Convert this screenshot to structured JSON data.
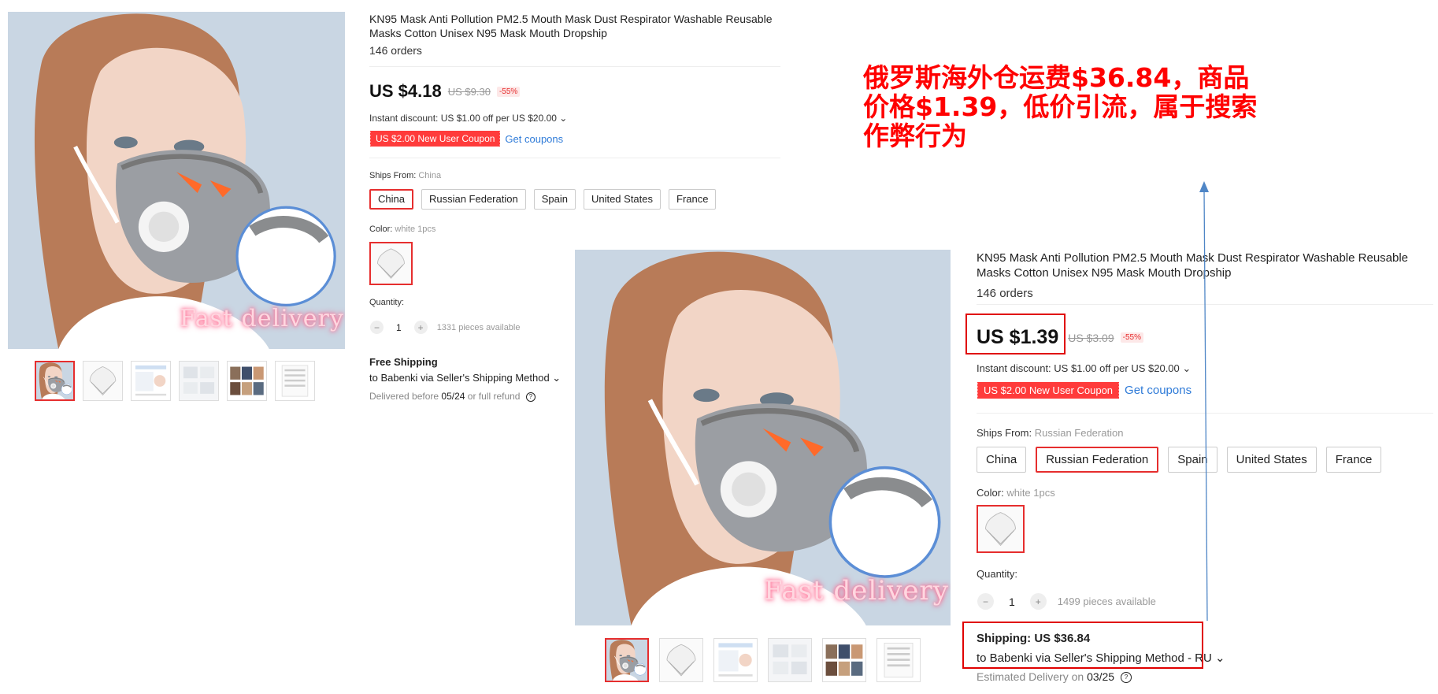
{
  "listing_a": {
    "title": "KN95 Mask Anti Pollution PM2.5 Mouth Mask Dust Respirator Washable Reusable Masks Cotton Unisex N95 Mask Mouth Dropship",
    "orders": "146 orders",
    "price": "US $4.18",
    "old_price": "US $9.30",
    "discount": "-55%",
    "instant_discount": "Instant discount: US $1.00 off per US $20.00 ⌄",
    "coupon": "US $2.00 New User Coupon",
    "get_coupons": "Get coupons",
    "ships_from_label": "Ships From:",
    "ships_from_value": "China",
    "ship_options": [
      "China",
      "Russian Federation",
      "Spain",
      "United States",
      "France"
    ],
    "color_label": "Color:",
    "color_value": "white 1pcs",
    "quantity_label": "Quantity:",
    "quantity": "1",
    "available": "1331 pieces available",
    "shipping_title": "Free Shipping",
    "shipping_method": "to Babenki via Seller's Shipping Method ⌄",
    "delivery_prefix": "Delivered before",
    "delivery_date": "05/24",
    "delivery_suffix": "or full refund",
    "photo_caption": "Fast delivery"
  },
  "listing_b": {
    "title": "KN95 Mask Anti Pollution PM2.5 Mouth Mask Dust Respirator Washable Reusable Masks Cotton Unisex N95 Mask Mouth Dropship",
    "orders": "146 orders",
    "price": "US $1.39",
    "old_price": "US $3.09",
    "discount": "-55%",
    "instant_discount": "Instant discount: US $1.00 off per US $20.00 ⌄",
    "coupon": "US $2.00 New User Coupon",
    "get_coupons": "Get coupons",
    "ships_from_label": "Ships From:",
    "ships_from_value": "Russian Federation",
    "ship_options": [
      "China",
      "Russian Federation",
      "Spain",
      "United States",
      "France"
    ],
    "color_label": "Color:",
    "color_value": "white 1pcs",
    "quantity_label": "Quantity:",
    "quantity": "1",
    "available": "1499 pieces available",
    "shipping_title": "Shipping: US $36.84",
    "shipping_method": "to Babenki via Seller's Shipping Method - RU ⌄",
    "delivery_prefix": "Estimated Delivery on",
    "delivery_date": "03/25",
    "photo_caption": "Fast delivery"
  },
  "annotation": {
    "text": "俄罗斯海外仓运费$36.84，商品\n价格$1.39，低价引流，属于搜索\n作弊行为",
    "color": "#ff0000"
  },
  "colors": {
    "accent": "#e62e2e",
    "link": "#2f7bd8",
    "coupon": "#ff3b3b"
  },
  "icons": {
    "help": "question-circle-icon",
    "minus": "minus-icon",
    "plus": "plus-icon"
  }
}
